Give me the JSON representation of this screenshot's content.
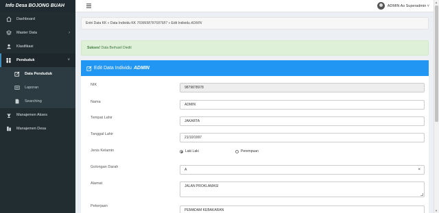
{
  "brand": "Info Desa BOJONG BUAH",
  "nav": {
    "dashboard": "Dashboard",
    "master_data": "Master Data",
    "klasifikasi": "Klasifikasi",
    "penduduk": "Penduduk",
    "data_penduduk": "Data Penduduk",
    "laporan": "Laporan",
    "searching": "Searching",
    "manajemen_akses": "Manajemen Akses",
    "manajemen_desa": "Manajemen Desa"
  },
  "topbar": {
    "user_label": "ADMIN As Superadmin ˅"
  },
  "breadcrumb": {
    "p1": "Entri Data KK » Data Individu KK",
    "kk": "7698698787687687",
    "p2": "» Edit Individu",
    "name": "ADMIN"
  },
  "alert": {
    "strong": "Sukses!",
    "text": "Data Berhasil Diedit"
  },
  "panel": {
    "title": "Edit Data Individu",
    "name": "ADMIN"
  },
  "form": {
    "nik_label": "NIK",
    "nik_value": "9879878978",
    "nama_label": "Nama",
    "nama_value": "ADMIN",
    "tempat_label": "Tempat Lahir",
    "tempat_value": "JAKARTA",
    "tanggal_label": "Tanggal Lahir",
    "tanggal_value": "21/10/1997",
    "jk_label": "Jenis Kelamin",
    "jk_option1": "Laki Laki",
    "jk_option2": "Perempuan",
    "goldar_label": "Golongan Darah",
    "goldar_value": "A",
    "alamat_label": "Alamat",
    "alamat_value": "JALAN PROKLAMASI",
    "pekerjaan_label": "Pekerjaan",
    "pekerjaan_value": "PEMADAM KEBAKARAN"
  },
  "colors": {
    "sidebar": "#222d32",
    "panel_header": "#2196f3",
    "alert_bg": "#dff0d8"
  }
}
